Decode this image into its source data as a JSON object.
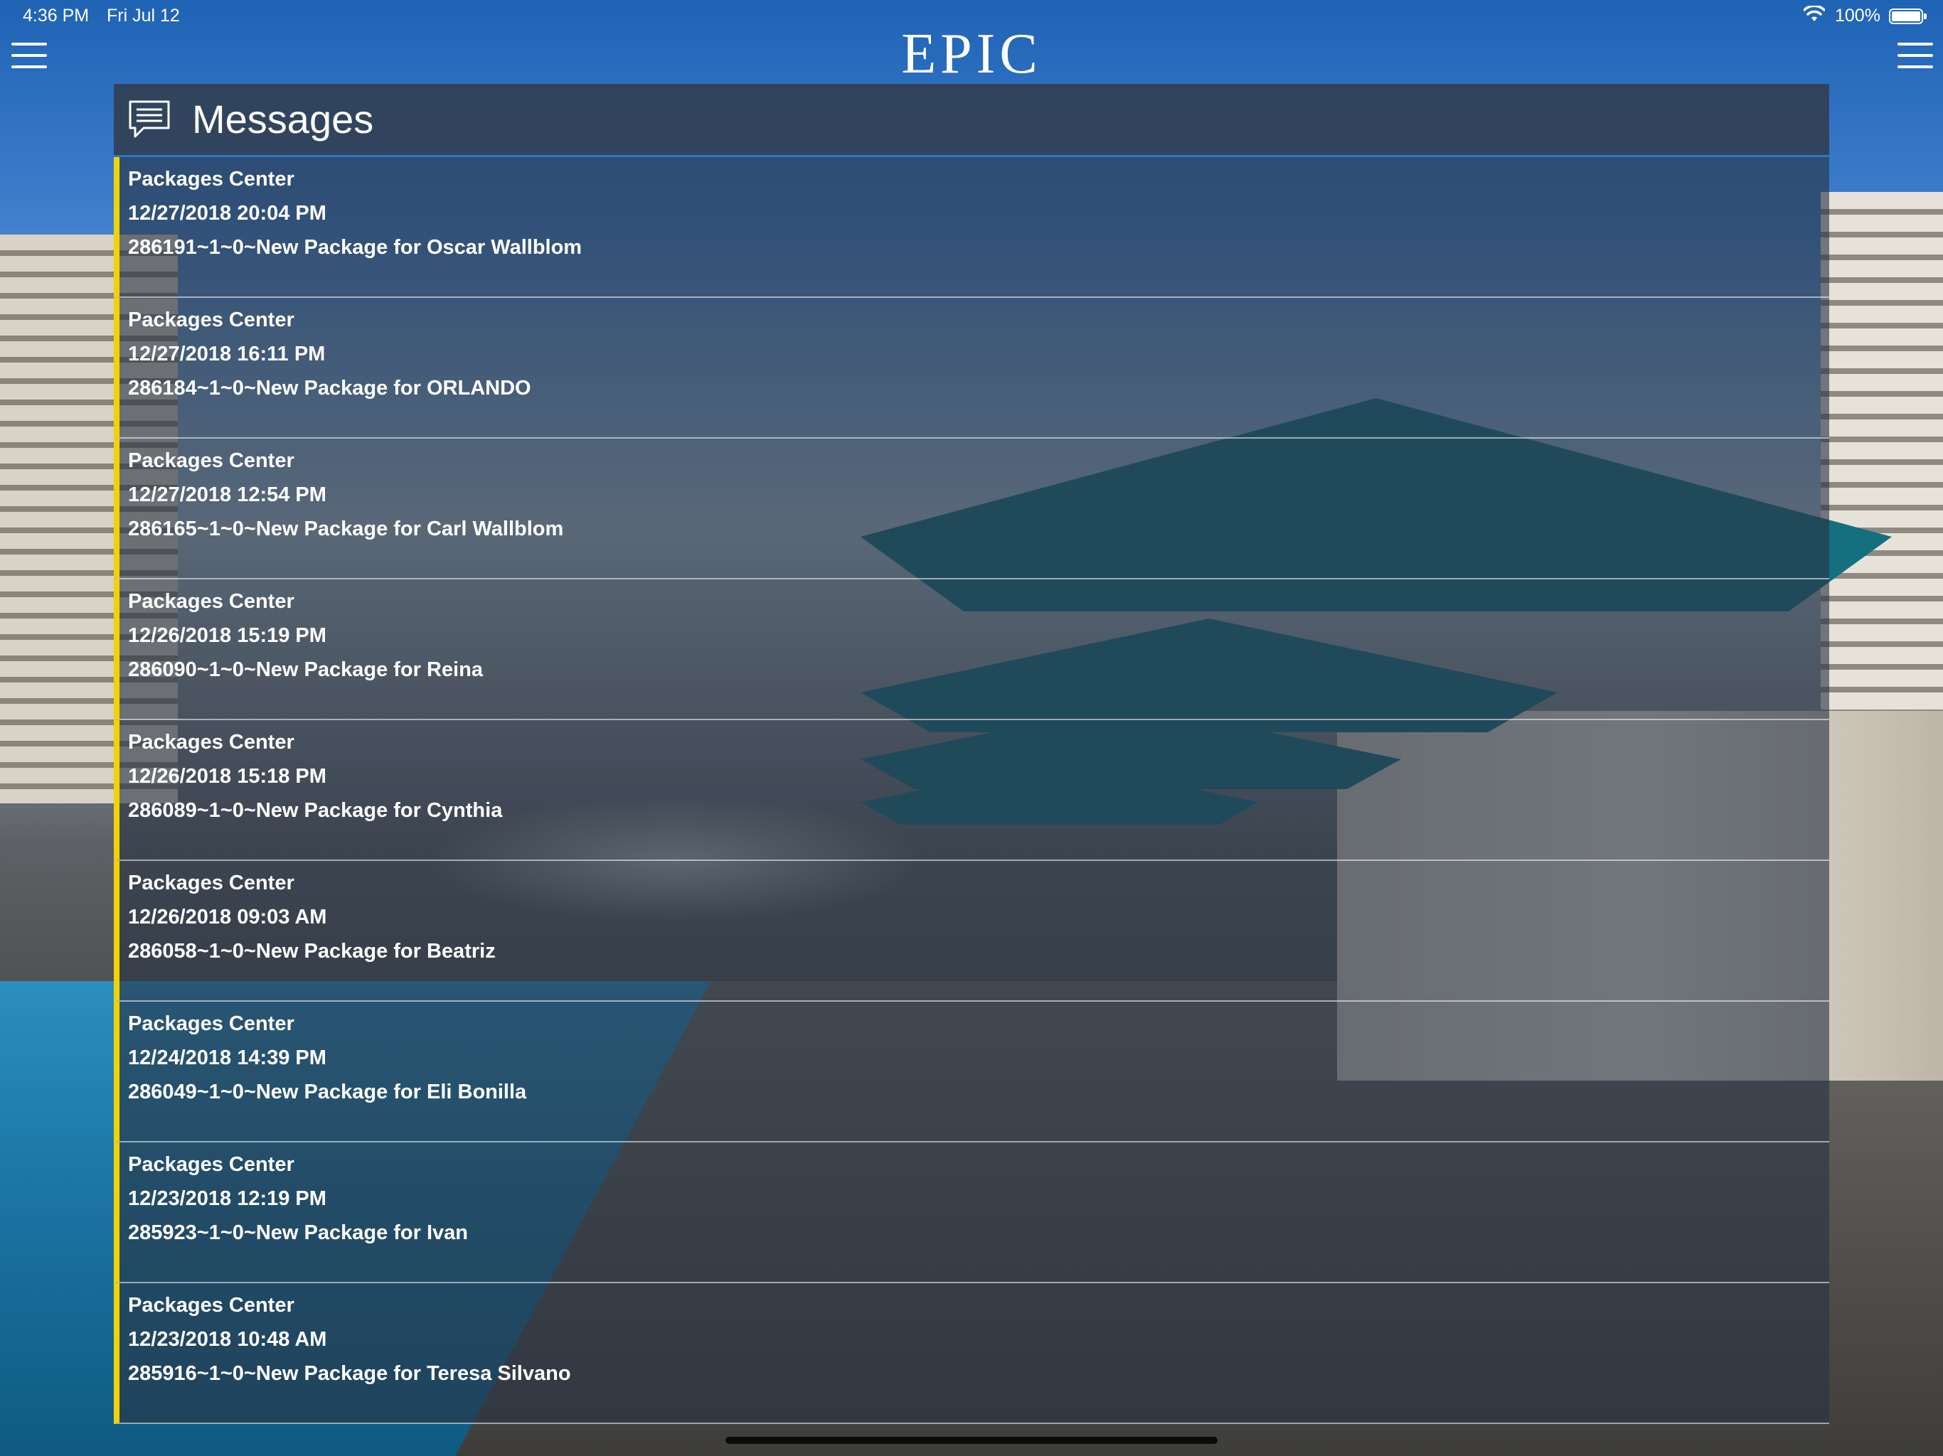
{
  "status_bar": {
    "time": "4:36 PM",
    "date": "Fri Jul 12",
    "battery": "100%",
    "battery_level": 1.0,
    "wifi_icon": "wifi-icon"
  },
  "header": {
    "logo_text": "EPIC",
    "left_menu_icon": "hamburger-menu-icon",
    "right_menu_icon": "hamburger-menu-icon"
  },
  "panel": {
    "title": "Messages",
    "title_icon": "chat-bubble-icon"
  },
  "colors": {
    "accent_bar": "#f2d206",
    "header_underline": "#2b79c2",
    "panel_bg": "#323e4e"
  },
  "messages": [
    {
      "sender": "Packages Center",
      "timestamp": "12/27/2018 20:04 PM",
      "body": "286191~1~0~New Package for Oscar Wallblom"
    },
    {
      "sender": "Packages Center",
      "timestamp": "12/27/2018 16:11 PM",
      "body": "286184~1~0~New Package for ORLANDO"
    },
    {
      "sender": "Packages Center",
      "timestamp": "12/27/2018 12:54 PM",
      "body": "286165~1~0~New Package for Carl Wallblom"
    },
    {
      "sender": "Packages Center",
      "timestamp": "12/26/2018 15:19 PM",
      "body": "286090~1~0~New Package for Reina"
    },
    {
      "sender": "Packages Center",
      "timestamp": "12/26/2018 15:18 PM",
      "body": "286089~1~0~New Package for Cynthia"
    },
    {
      "sender": "Packages Center",
      "timestamp": "12/26/2018 09:03 AM",
      "body": "286058~1~0~New Package for Beatriz"
    },
    {
      "sender": "Packages Center",
      "timestamp": "12/24/2018 14:39 PM",
      "body": "286049~1~0~New Package for Eli Bonilla"
    },
    {
      "sender": "Packages Center",
      "timestamp": "12/23/2018 12:19 PM",
      "body": "285923~1~0~New Package for Ivan"
    },
    {
      "sender": "Packages Center",
      "timestamp": "12/23/2018 10:48 AM",
      "body": "285916~1~0~New Package for Teresa Silvano"
    }
  ]
}
